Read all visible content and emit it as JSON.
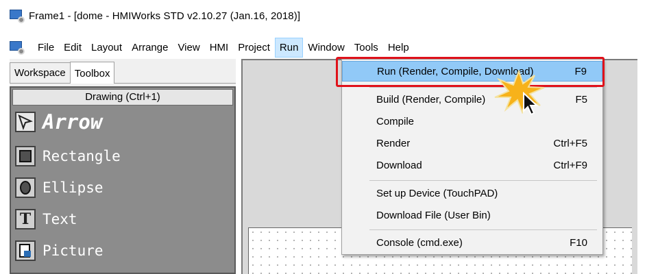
{
  "window": {
    "title": "Frame1 - [dome - HMIWorks STD v2.10.27 (Jan.16, 2018)]"
  },
  "menubar": [
    "File",
    "Edit",
    "Layout",
    "Arrange",
    "View",
    "HMI",
    "Project",
    "Run",
    "Window",
    "Tools",
    "Help"
  ],
  "panel": {
    "tabs": [
      "Workspace",
      "Toolbox"
    ],
    "group_header": "Drawing (Ctrl+1)",
    "tools": [
      {
        "label": "Arrow",
        "icon": "arrow-icon"
      },
      {
        "label": "Rectangle",
        "icon": "rectangle-icon"
      },
      {
        "label": "Ellipse",
        "icon": "ellipse-icon"
      },
      {
        "label": "Text",
        "icon": "text-icon"
      },
      {
        "label": "Picture",
        "icon": "picture-icon"
      }
    ]
  },
  "run_menu": {
    "items": [
      {
        "label": "Run (Render, Compile, Download)",
        "shortcut": "F9"
      },
      {
        "label": "Build (Render, Compile)",
        "shortcut": "F5"
      },
      {
        "label": "Compile",
        "shortcut": ""
      },
      {
        "label": "Render",
        "shortcut": "Ctrl+F5"
      },
      {
        "label": "Download",
        "shortcut": "Ctrl+F9"
      },
      {
        "label": "Set up Device (TouchPAD)",
        "shortcut": ""
      },
      {
        "label": "Download File (User Bin)",
        "shortcut": ""
      },
      {
        "label": "Console (cmd.exe)",
        "shortcut": "F10"
      }
    ]
  },
  "colors": {
    "highlight": "#91c9f7",
    "callout": "#e0111a",
    "burst": "#f7b21a"
  }
}
